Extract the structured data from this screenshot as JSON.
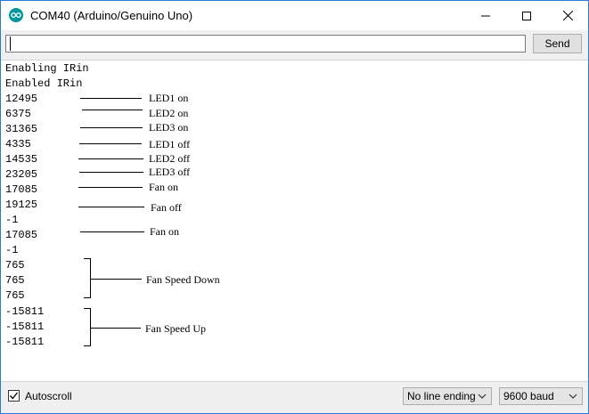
{
  "window": {
    "title": "COM40 (Arduino/Genuino Uno)"
  },
  "toolbar": {
    "input_value": "",
    "send_label": "Send"
  },
  "serial_lines": [
    "Enabling IRin",
    "Enabled IRin",
    "12495",
    "6375",
    "31365",
    "4335",
    "14535",
    "23205",
    "17085",
    "19125",
    "-1",
    "17085",
    "-1",
    "765",
    "765",
    "765",
    "-15811",
    "-15811",
    "-15811"
  ],
  "annotations": [
    "LED1 on",
    "LED2 on",
    "LED3 on",
    "LED1 off",
    "LED2 off",
    "LED3 off",
    "Fan on",
    "Fan off",
    "Fan on",
    "Fan Speed Down",
    "Fan Speed Up"
  ],
  "statusbar": {
    "autoscroll_label": "Autoscroll",
    "autoscroll_checked": true,
    "line_ending": "No line ending",
    "baud_rate": "9600 baud"
  },
  "colors": {
    "window_border": "#2b79d8",
    "arduino_icon": "#00979c"
  }
}
